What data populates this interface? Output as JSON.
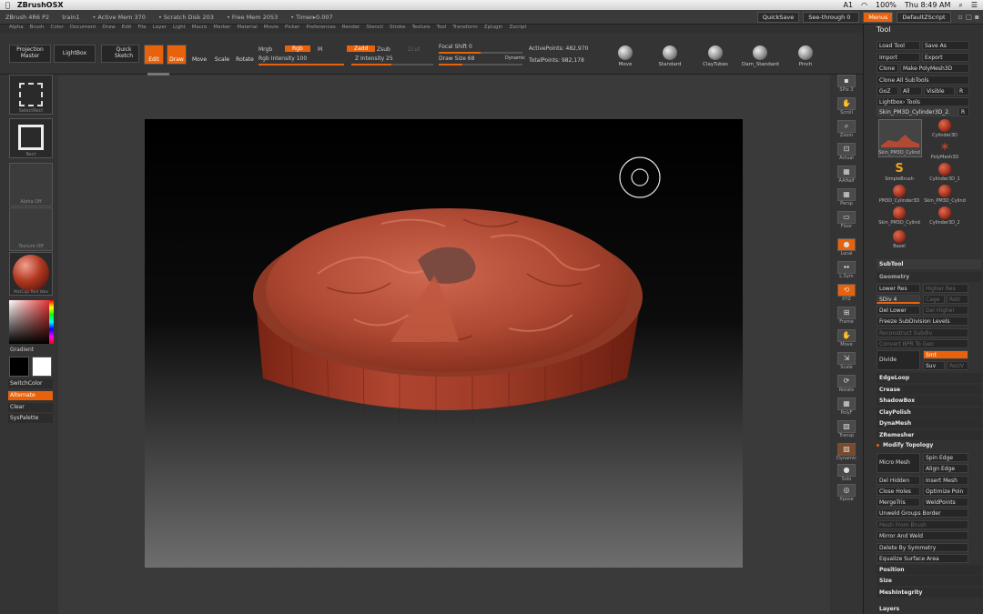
{
  "mac_menubar": {
    "app_name": "ZBrushOSX",
    "right_items": [
      "A1",
      "100%",
      "Thu 8:49 AM"
    ]
  },
  "titlebar": {
    "items": [
      "ZBrush 4R6 P2",
      "train1",
      "• Active Mem 370",
      "• Scratch Disk 203",
      "• Free Mem 2053",
      "• Timer▸0.007"
    ],
    "quicksave": "QuickSave",
    "see_through": "See-through  0",
    "menus_btn": "Menus",
    "default_script": "DefaultZScript"
  },
  "menus": [
    "Alpha",
    "Brush",
    "Color",
    "Document",
    "Draw",
    "Edit",
    "File",
    "Layer",
    "Light",
    "Macro",
    "Marker",
    "Material",
    "Movie",
    "Picker",
    "Preferences",
    "Render",
    "Stencil",
    "Stroke",
    "Texture",
    "Tool",
    "Transform",
    "Zplugin",
    "Zscript"
  ],
  "toolbar": {
    "projection_master": "Projection Master",
    "lightbox": "LightBox",
    "quick_sketch": "Quick Sketch",
    "edit": "Edit",
    "draw": "Draw",
    "move": "Move",
    "scale": "Scale",
    "rotate": "Rotate",
    "mrgb": "Mrgb",
    "rgb": "Rgb",
    "m": "M",
    "rgb_intensity": "Rgb Intensity 100",
    "zadd": "Zadd",
    "zsub": "Zsub",
    "zcut": "Zcut",
    "z_intensity": "Z Intensity 25",
    "focal_shift": "Focal Shift 0",
    "draw_size": "Draw Size 68",
    "dynamic": "Dynamic",
    "active_points": "ActivePoints: 482,970",
    "total_points": "TotalPoints: 982,178",
    "brushes": [
      "Move",
      "Standard",
      "ClayTubes",
      "Dam_Standard",
      "Pinch"
    ]
  },
  "left_shelf": {
    "select_rect": "SelectRect",
    "rect": "Rect",
    "alpha_off": "Alpha Off",
    "texture_off": "Texture Off",
    "material": "MatCap Red Wax",
    "gradient": "Gradient",
    "switch_color": "SwitchColor",
    "alternate": "Alternate",
    "clear": "Clear",
    "syspalette": "SysPalette"
  },
  "right_shelf": [
    "SPix 3",
    "Scroll",
    "Zoom",
    "Actual",
    "AAHalf",
    "Persp",
    "Floor",
    "Local",
    "L.Sym",
    "XYZ",
    "Frame",
    "Move",
    "Scale",
    "Rotate",
    "PolyF",
    "Transp",
    "Dynamic",
    "Solo",
    "Xpose"
  ],
  "tool_panel": {
    "title": "Tool",
    "load_tool": "Load Tool",
    "save_as": "Save As",
    "import": "Import",
    "export": "Export",
    "clone": "Clone",
    "make_polymesh": "Make PolyMesh3D",
    "clone_all": "Clone All SubTools",
    "goz": "GoZ",
    "all": "All",
    "visible": "Visible",
    "r": "R",
    "lightbox_tools": "Lightbox› Tools",
    "current_tool": "Skin_PM3D_Cylinder3D_2.",
    "thumbs": [
      {
        "label": "Skin_PM3D_Cylind",
        "count": "2"
      },
      {
        "label": "Cylinder3D",
        "count": "2"
      },
      {
        "label": "PolyMesh3D",
        "count": ""
      },
      {
        "label": "SimpleBrush",
        "count": ""
      },
      {
        "label": "Cylinder3D_1",
        "count": ""
      },
      {
        "label": "PM3D_Cylinder3D",
        "count": "2"
      },
      {
        "label": "Skin_PM3D_Cylind",
        "count": "2"
      },
      {
        "label": "Skin_PM3D_Cylind",
        "count": "2"
      },
      {
        "label": "Cylinder3D_2",
        "count": ""
      },
      {
        "label": "Bazel",
        "count": ""
      }
    ],
    "subtool": "SubTool",
    "geometry": "Geometry",
    "lower_res": "Lower Res",
    "higher_res": "Higher Res",
    "sdiv": "SDiv 4",
    "cage": "Cage",
    "rstr": "Rstr",
    "del_lower": "Del Lower",
    "del_higher": "Del Higher",
    "freeze_subdiv": "Freeze SubDivision Levels",
    "reconstruct": "Reconstruct Subdiv",
    "convert_bpr": "Convert BPR To Geo",
    "divide": "Divide",
    "smt": "Smt",
    "suv": "Suv",
    "reuv": "ReUV",
    "items": [
      "EdgeLoop",
      "Crease",
      "ShadowBox",
      "ClayPolish",
      "DynaMesh",
      "ZRemesher"
    ],
    "modify_topology": "Modify Topology",
    "micro_mesh": "Micro Mesh",
    "spin_edge": "Spin Edge",
    "align_edge": "Align Edge",
    "del_hidden": "Del Hidden",
    "insert_mesh": "Insert Mesh",
    "close_holes": "Close Holes",
    "optimize_points": "Optimize Poin",
    "merge_tris": "MergeTris",
    "weld_points": "WeldPoints",
    "unweld_groups": "Unweld Groups Border",
    "mesh_from_brush": "Mesh From Brush",
    "mirror_weld": "Mirror And Weld",
    "delete_symmetry": "Delete By Symmetry",
    "equalize": "Equalize Surface Area",
    "position": "Position",
    "size": "Size",
    "mesh_integrity": "MeshIntegrity",
    "layers": "Layers"
  },
  "colors": {
    "accent": "#e8620c",
    "clay": "#a8402c"
  }
}
